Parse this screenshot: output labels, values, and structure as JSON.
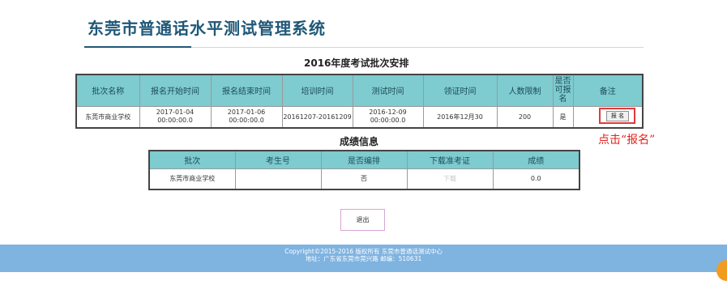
{
  "header": {
    "title": "东莞市普通话水平测试管理系统"
  },
  "schedule": {
    "title": "2016年度考试批次安排",
    "columns": [
      "批次名称",
      "报名开始时间",
      "报名结束时间",
      "培训时间",
      "测试时间",
      "领证时间",
      "人数限制",
      "是否可报名",
      "备注"
    ],
    "rows": [
      {
        "batch": "东莞市商业学校",
        "signup_start": [
          "2017-01-04",
          "00:00:00.0"
        ],
        "signup_end": [
          "2017-01-06",
          "00:00:00.0"
        ],
        "training": "20161207-20161209",
        "test_time": [
          "2016-12-09",
          "00:00:00.0"
        ],
        "certificate_time": "2016年12月30",
        "limit": "200",
        "can_signup": "是",
        "action_label": "报 名"
      }
    ]
  },
  "hint": "点击“报名”",
  "scores": {
    "title": "成绩信息",
    "columns": [
      "批次",
      "考生号",
      "是否编排",
      "下载准考证",
      "成绩"
    ],
    "rows": [
      {
        "batch": "东莞市商业学校",
        "candidate_no": "",
        "arranged": "否",
        "download": "下载",
        "score": "0.0"
      }
    ]
  },
  "exit_label": "退出",
  "footer": {
    "line1": "Copyright©2015-2016 版权所有 东莞市普通话测试中心",
    "line2": "地址：广东省东莞市莞兴路 邮编：510631"
  }
}
